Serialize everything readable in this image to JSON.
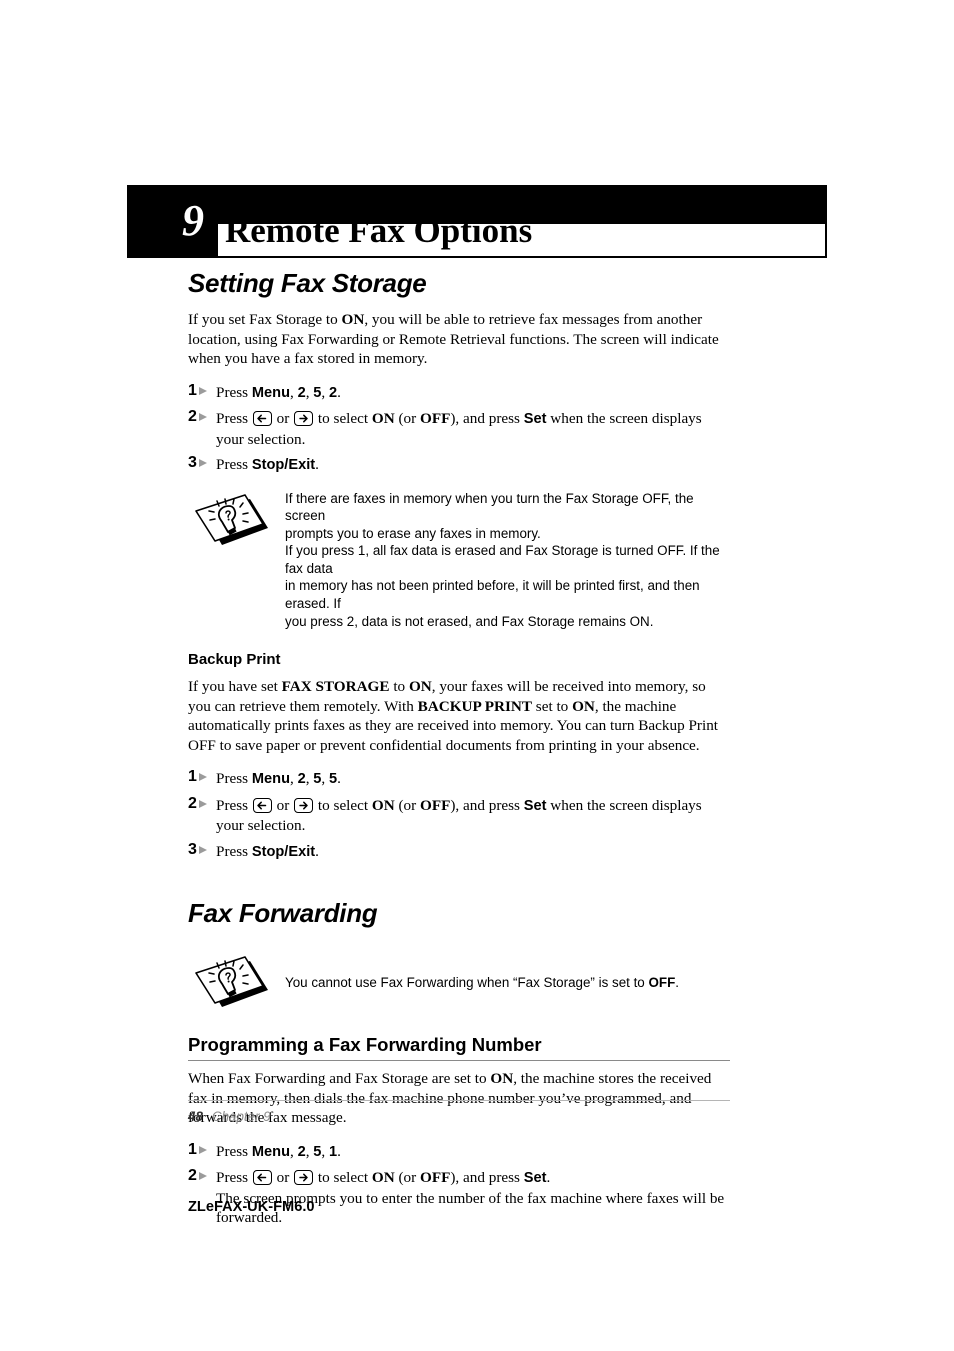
{
  "chapter": {
    "number": "9",
    "title": "Remote Fax Options"
  },
  "sections": {
    "fax_storage": {
      "heading": "Setting Fax Storage",
      "intro_1": "If you set Fax Storage to ",
      "intro_on": "ON",
      "intro_2": ", you will be able to retrieve fax messages from another location, using Fax Forwarding or Remote Retrieval functions. The screen will indicate when you have a fax stored in memory.",
      "steps": [
        {
          "num": "1",
          "press": "Press ",
          "key": "Menu",
          "sep1": ", ",
          "k2": "2",
          "sep2": ", ",
          "k3": "5",
          "sep3": ", ",
          "k4": "2",
          "end": "."
        },
        {
          "num": "2",
          "press": "Press ",
          "left_icon": "arrow-left-key-icon",
          "or": " or ",
          "right_icon": "arrow-right-key-icon",
          "mid": " to select ",
          "on": "ON",
          "paren_open": " (or ",
          "off": "OFF",
          "paren_close": "), and press ",
          "set": "Set",
          "tail": " when the screen displays your selection."
        },
        {
          "num": "3",
          "press": "Press ",
          "key": "Stop/Exit",
          "end": "."
        }
      ],
      "note": {
        "icon": "tip-lightbulb-icon",
        "lines": [
          "If there are faxes in memory when you turn the Fax Storage OFF, the screen",
          "prompts you to erase any faxes in memory.",
          "If you press 1, all fax data is erased and Fax Storage is turned OFF. If the fax data",
          "in memory has not been printed before, it will be printed first, and then erased. If",
          "you press 2, data is not erased, and Fax Storage remains ON."
        ]
      }
    },
    "backup_print": {
      "heading": "Backup Print",
      "body_1": "If you have set ",
      "b1": "FAX STORAGE",
      "body_2": " to ",
      "b2": "ON",
      "body_3": ", your faxes will be received into memory, so you can retrieve them remotely. With ",
      "b3": "BACKUP PRINT",
      "body_4": " set to ",
      "b4": "ON",
      "body_5": ", the machine automatically prints faxes as they are received into memory. You can turn Backup Print OFF to save paper or prevent confidential documents from printing in your absence.",
      "steps": [
        {
          "num": "1",
          "press": "Press ",
          "key": "Menu",
          "sep1": ", ",
          "k2": "2",
          "sep2": ", ",
          "k3": "5",
          "sep3": ", ",
          "k4": "5",
          "end": "."
        },
        {
          "num": "2",
          "press": "Press ",
          "left_icon": "arrow-left-key-icon",
          "or": " or ",
          "right_icon": "arrow-right-key-icon",
          "mid": " to select ",
          "on": "ON",
          "paren_open": " (or ",
          "off": "OFF",
          "paren_close": "), and press ",
          "set": "Set",
          "tail": " when the screen displays your selection."
        },
        {
          "num": "3",
          "press": "Press ",
          "key": "Stop/Exit",
          "end": "."
        }
      ]
    },
    "fax_forwarding": {
      "heading": "Fax Forwarding",
      "note": {
        "icon": "tip-lightbulb-icon",
        "text_1": "You cannot use Fax Forwarding when “Fax Storage” is set to ",
        "off": "OFF",
        "text_2": "."
      },
      "sub_heading": "Programming a Fax Forwarding Number",
      "body_1": "When Fax Forwarding and Fax Storage are set to ",
      "b1": "ON",
      "body_2": ", the machine stores the received fax in memory, then dials the fax machine phone number you’ve programmed, and forwards the fax message.",
      "steps": [
        {
          "num": "1",
          "press": "Press ",
          "key": "Menu",
          "sep1": ", ",
          "k2": "2",
          "sep2": ", ",
          "k3": "5",
          "sep3": ", ",
          "k4": "1",
          "end": "."
        },
        {
          "num": "2",
          "press": "Press ",
          "left_icon": "arrow-left-key-icon",
          "or": " or ",
          "right_icon": "arrow-right-key-icon",
          "mid": " to select ",
          "on": "ON",
          "paren_open": " (or ",
          "off": "OFF",
          "paren_close": "), and press ",
          "set": "Set",
          "end": ".",
          "sub": "The screen prompts you to enter the number of the fax machine where faxes will be forwarded."
        }
      ]
    }
  },
  "footer": {
    "page_number": "48",
    "chapter_label": "Chapter 9",
    "doc_code": "ZLeFAX-UK-FM6.0"
  }
}
